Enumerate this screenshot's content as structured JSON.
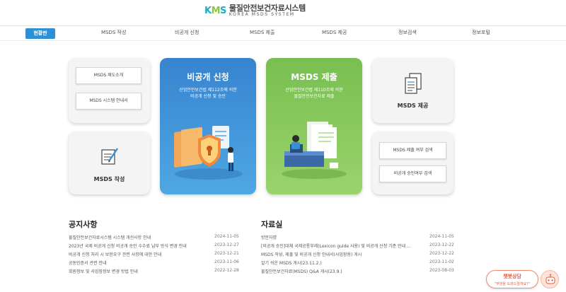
{
  "header": {
    "logo_k": "K",
    "logo_m": "M",
    "logo_s": "S",
    "title": "물질안전보건자료시스템",
    "subtitle": "KOREA MSDS SYSTEM"
  },
  "nav": {
    "active": "현황판",
    "items": [
      "MSDS 작성",
      "비공개 신청",
      "MSDS 제출",
      "MSDS 제공",
      "정보검색",
      "정보포털"
    ]
  },
  "cards": {
    "guide": {
      "btn1": "MSDS 제도소개",
      "btn2": "MSDS 시스템 안내서"
    },
    "write": {
      "title": "MSDS 작성"
    },
    "nondisclosure": {
      "title": "비공개 신청",
      "desc1": "산업안전보건법 제112조에 의한",
      "desc2": "비공개 신청 및 승인"
    },
    "submit": {
      "title": "MSDS 제출",
      "desc1": "산업안전보건법 제110조에 의한",
      "desc2": "물질안전보건자료 제출"
    },
    "provide": {
      "title": "MSDS 제공"
    },
    "search": {
      "btn1": "MSDS 제출 여부 검색",
      "btn2": "비공개 승인여부 검색"
    }
  },
  "notices": {
    "title": "공지사항",
    "rows": [
      {
        "text": "물질안전보건자료시스템 시스템 개선사항 안내",
        "date": "2024-11-05"
      },
      {
        "text": "2023년 국제 비공개 신청 비공개 승인 수수료 납부 방식 변경 안내",
        "date": "2023-12-27"
      },
      {
        "text": "비공개 신청 처리 시 보완요구 관련 사항에 대한 안내",
        "date": "2023-12-21"
      },
      {
        "text": "공동인증서 관련 안내",
        "date": "2023-11-06"
      },
      {
        "text": "회원정보 및 사업장정보 변경 방법 안내",
        "date": "2022-12-28"
      }
    ]
  },
  "archive": {
    "title": "자료실",
    "rows": [
      {
        "text": "방문자명",
        "date": "2024-11-05"
      },
      {
        "text": "[비공개 승인]대체 국제공통부레(Lexicon guide 사용) 및 비공개 신청 기준 안내 ...",
        "date": "2023-12-22"
      },
      {
        "text": "MSDS 작성, 제출 및 비공개 신청 안내서(사업장용) 게시",
        "date": "2023-12-22"
      },
      {
        "text": "알기 쉬운 MSDS 게시(23.11.2.)",
        "date": "2023-11-02"
      },
      {
        "text": "물질안전보건자료(MSDS) Q&A 게시(23.9.)",
        "date": "2023-08-03"
      }
    ]
  },
  "chat": {
    "title": "챗봇상담",
    "subtitle": "\"무엇을 도와드릴까요?\""
  },
  "colors": {
    "nav_active": "#2d8fd5",
    "nondisclosure_card": "#3a8fd3",
    "submit_card": "#82c659",
    "chat_accent": "#e8573a"
  }
}
